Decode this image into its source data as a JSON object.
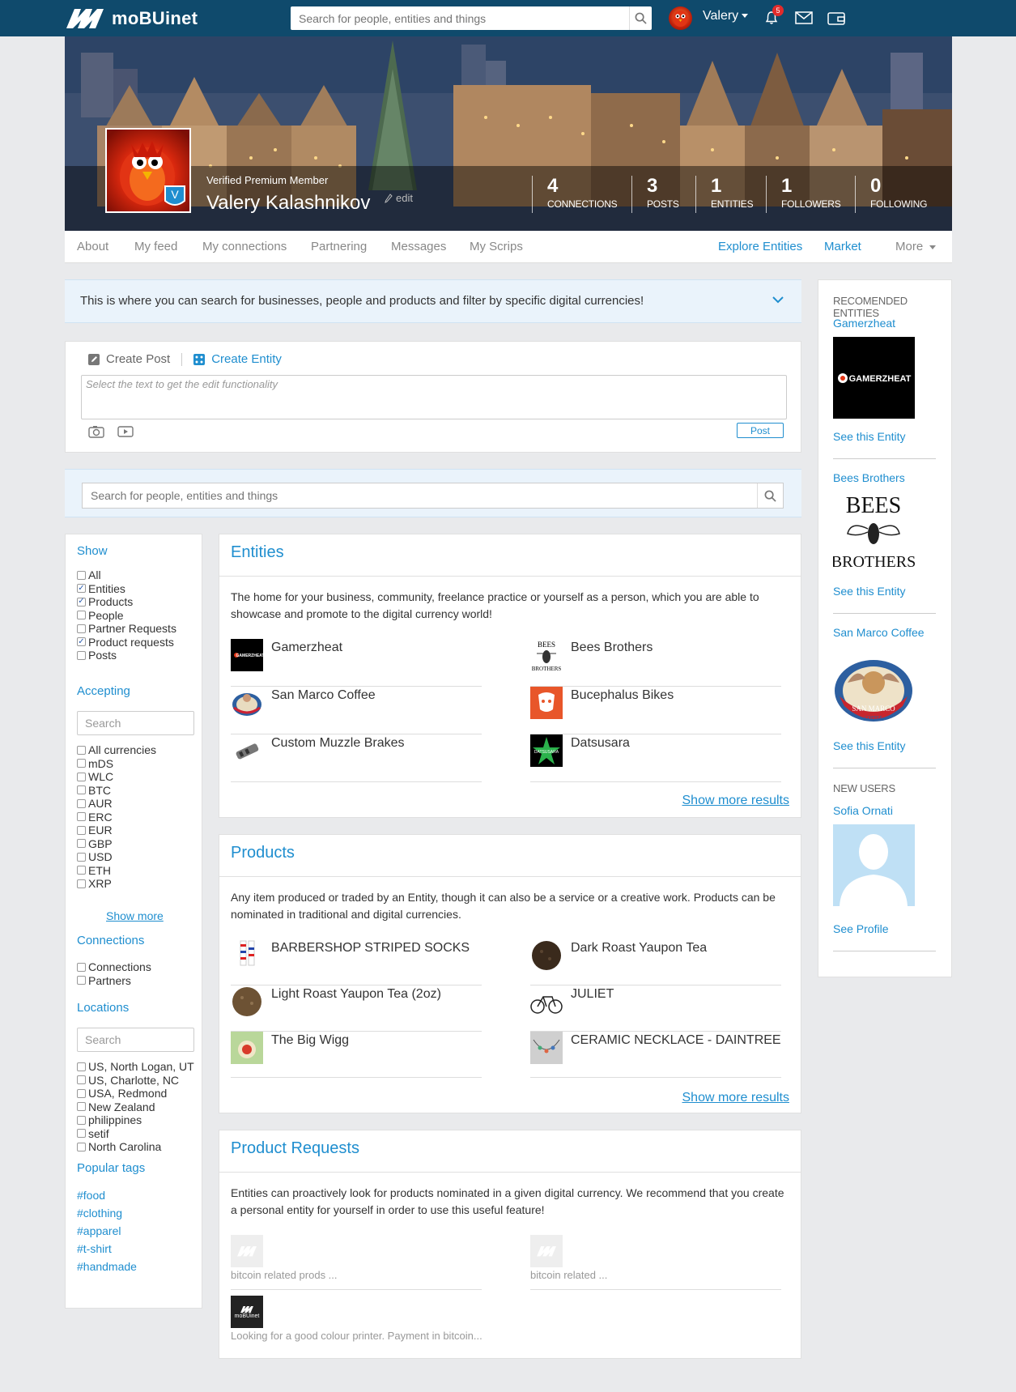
{
  "app": {
    "logo_text": "moBUinet",
    "brand_color": "#0f4a6c",
    "accent_color": "#1f8ecf"
  },
  "topbar": {
    "search_placeholder": "Search for people, entities and things",
    "user_name": "Valery",
    "notification_count": "5",
    "icons": [
      "search-icon",
      "bell-icon",
      "envelope-icon",
      "wallet-icon"
    ]
  },
  "profile": {
    "verified_label": "Verified Premium Member",
    "name": "Valery Kalashnikov",
    "edit_label": "edit",
    "stats": [
      {
        "value": "4",
        "label": "CONNECTIONS"
      },
      {
        "value": "3",
        "label": "POSTS"
      },
      {
        "value": "1",
        "label": "ENTITIES"
      },
      {
        "value": "1",
        "label": "FOLLOWERS"
      },
      {
        "value": "0",
        "label": "FOLLOWING"
      }
    ]
  },
  "tabs": {
    "left": [
      "About",
      "My feed",
      "My connections",
      "Partnering",
      "Messages",
      "My Scrips"
    ],
    "right": [
      "Explore Entities",
      "Market",
      "More"
    ]
  },
  "banner": {
    "text": "This is where you can search for businesses, people and products and filter by specific digital currencies!"
  },
  "create": {
    "post_label": "Create Post",
    "entity_label": "Create Entity",
    "placeholder": "Select the text to get the edit functionality",
    "post_button": "Post"
  },
  "search": {
    "placeholder": "Search for people, entities and things"
  },
  "filters": {
    "show_title": "Show",
    "show_options": [
      {
        "label": "All",
        "checked": false
      },
      {
        "label": "Entities",
        "checked": true
      },
      {
        "label": "Products",
        "checked": true
      },
      {
        "label": "People",
        "checked": false
      },
      {
        "label": "Partner Requests",
        "checked": false
      },
      {
        "label": "Product requests",
        "checked": true
      },
      {
        "label": "Posts",
        "checked": false
      }
    ],
    "accepting_title": "Accepting",
    "accepting_search": "Search",
    "currencies": [
      "All currencies",
      "mDS",
      "WLC",
      "BTC",
      "AUR",
      "ERC",
      "EUR",
      "GBP",
      "USD",
      "ETH",
      "XRP"
    ],
    "show_more": "Show more",
    "connections_title": "Connections",
    "connections": [
      "Connections",
      "Partners"
    ],
    "locations_title": "Locations",
    "locations_search": "Search",
    "locations": [
      "US, North Logan, UT",
      "US, Charlotte, NC",
      "USA, Redmond",
      "New Zealand",
      "philippines",
      "setif",
      "North Carolina"
    ],
    "tags_title": "Popular tags",
    "tags": [
      "#food",
      "#clothing",
      "#apparel",
      "#t-shirt",
      "#handmade"
    ]
  },
  "entities": {
    "title": "Entities",
    "description": "The home for your business, community, freelance practice or yourself as a person, which you are able to showcase and promote to the digital currency world!",
    "items": [
      "Gamerzheat",
      "Bees Brothers",
      "San Marco Coffee",
      "Bucephalus Bikes",
      "Custom Muzzle Brakes",
      "Datsusara"
    ],
    "show_more": "Show more results"
  },
  "products": {
    "title": "Products",
    "description": "Any item produced or traded by an Entity, though it can also be a service or a creative work. Products can be nominated in traditional and digital currencies.",
    "items": [
      "BARBERSHOP STRIPED SOCKS",
      "Dark Roast Yaupon Tea",
      "Light Roast Yaupon Tea (2oz)",
      "JULIET",
      "The Big Wigg",
      "CERAMIC NECKLACE - DAINTREE"
    ],
    "show_more": "Show more results"
  },
  "requests": {
    "title": "Product Requests",
    "description": "Entities can proactively look for products nominated in a given digital currency. We recommend that you create a personal entity for yourself in order to use this useful feature!",
    "items": [
      "bitcoin related prods ...",
      "bitcoin related ...",
      "Looking for a good colour printer. Payment in bitcoin..."
    ],
    "badge_text": "moBUinet"
  },
  "recommended": {
    "title": "RECOMENDED ENTITIES",
    "entities": [
      {
        "name": "Gamerzheat",
        "logo_text": "GAMERZHEAT",
        "link": "See this Entity"
      },
      {
        "name": "Bees Brothers",
        "logo_text_top": "BEES",
        "logo_text_bottom": "BROTHERS",
        "link": "See this Entity"
      },
      {
        "name": "San Marco Coffee",
        "logo_text": "SAN MARCO",
        "logo_sub": "COFFEE",
        "link": "See this Entity"
      }
    ],
    "new_users_title": "NEW USERS",
    "new_user": {
      "name": "Sofia Ornati",
      "link": "See Profile"
    }
  }
}
